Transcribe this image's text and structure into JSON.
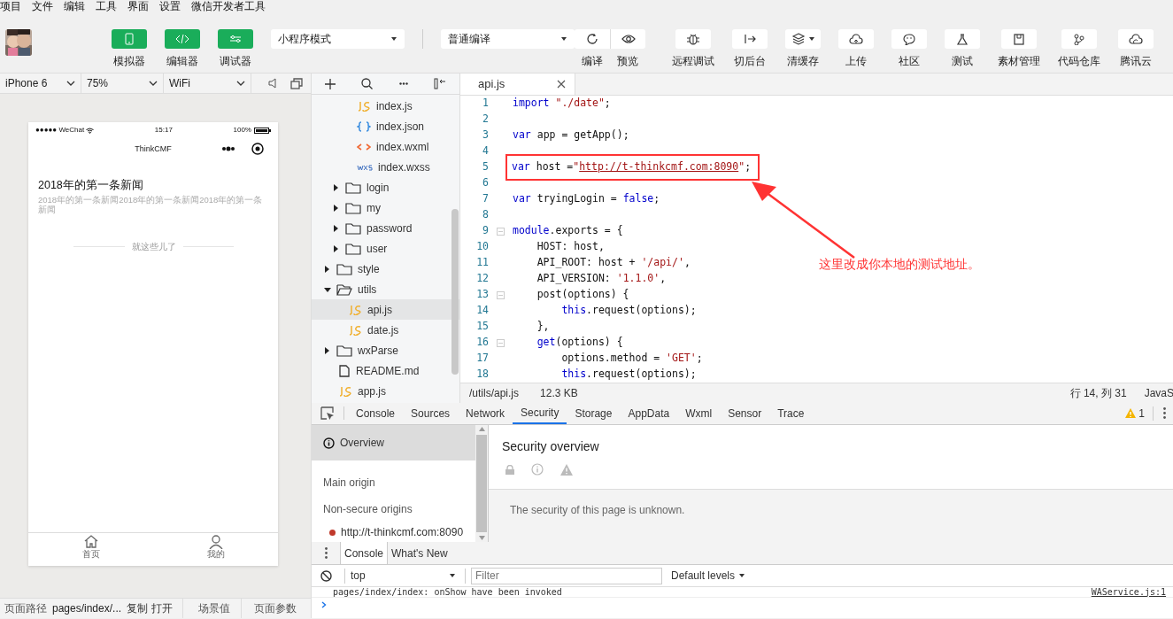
{
  "menu": [
    "项目",
    "文件",
    "编辑",
    "工具",
    "界面",
    "设置",
    "微信开发者工具"
  ],
  "toolbar": {
    "view_toggles": [
      {
        "label": "模拟器",
        "on": true
      },
      {
        "label": "编辑器",
        "on": true
      },
      {
        "label": "调试器",
        "on": true
      }
    ],
    "mode_select": {
      "value": "小程序模式"
    },
    "compile_select": {
      "value": "普通编译"
    },
    "compile_actions": [
      {
        "label": "编译"
      },
      {
        "label": "预览"
      }
    ],
    "actions": [
      {
        "label": "远程调试"
      },
      {
        "label": "切后台"
      },
      {
        "label": "清缓存",
        "has_menu": true
      },
      {
        "label": "上传"
      },
      {
        "label": "社区"
      },
      {
        "label": "测试"
      },
      {
        "label": "素材管理"
      },
      {
        "label": "代码仓库"
      },
      {
        "label": "腾讯云"
      }
    ]
  },
  "simulator": {
    "device": "iPhone 6",
    "zoom": "75%",
    "network": "WiFi",
    "phone": {
      "carrier": "●●●●● WeChat",
      "time": "15:17",
      "battery": "100%",
      "nav_title": "ThinkCMF",
      "news": [
        {
          "title": "2018年的第一条新闻",
          "summary": "2018年的第一条新闻2018年的第一条新闻2018年的第一条新闻"
        }
      ],
      "end_text": "就这些儿了",
      "tabs": [
        {
          "label": "首页"
        },
        {
          "label": "我的"
        }
      ]
    }
  },
  "page_status": {
    "path_label": "页面路径",
    "path": "pages/index/...",
    "copy": "复制",
    "open": "打开",
    "scene": "场景值",
    "params": "页面参数"
  },
  "file_tree": [
    {
      "children": [
        {
          "children": [
            {
              "name": "index.js",
              "kind": "js",
              "selected": false
            },
            {
              "name": "index.json",
              "kind": "json",
              "selected": false
            },
            {
              "name": "index.wxml",
              "kind": "wxml",
              "selected": false
            },
            {
              "name": "index.wxss",
              "kind": "wxss",
              "selected": false
            }
          ]
        },
        {
          "name": "login",
          "kind": "folder",
          "expanded": false,
          "selected": false
        },
        {
          "name": "my",
          "kind": "folder",
          "expanded": false,
          "selected": false
        },
        {
          "name": "password",
          "kind": "folder",
          "expanded": false,
          "selected": false
        },
        {
          "name": "user",
          "kind": "folder",
          "expanded": false,
          "selected": false
        }
      ]
    },
    {
      "name": "style",
      "kind": "folder",
      "expanded": false,
      "selected": false
    },
    {
      "name": "utils",
      "kind": "folder",
      "expanded": true,
      "selected": false,
      "children": [
        {
          "name": "api.js",
          "kind": "js",
          "selected": true
        },
        {
          "name": "date.js",
          "kind": "js",
          "selected": false
        }
      ]
    },
    {
      "name": "wxParse",
      "kind": "folder",
      "expanded": false,
      "selected": false
    },
    {
      "name": "README.md",
      "kind": "file",
      "selected": false
    },
    {
      "name": "app.js",
      "kind": "js",
      "selected": false
    }
  ],
  "editor": {
    "tabs": [
      {
        "label": "api.js",
        "selected": true
      }
    ],
    "lines": [
      {
        "number": "1",
        "tokens": [
          {
            "kind": "keyword",
            "text": "import"
          },
          {
            "kind": "string",
            "text": " \"./date\""
          },
          {
            "kind": "plain",
            "text": ";"
          }
        ]
      },
      {
        "number": "2"
      },
      {
        "number": "3",
        "tokens": [
          {
            "kind": "keyword",
            "text": "var"
          },
          {
            "kind": "plain",
            "text": " app = getApp();"
          }
        ]
      },
      {
        "number": "4"
      },
      {
        "number": "5",
        "highlighted": true,
        "tokens": [
          {
            "kind": "keyword",
            "text": "var"
          },
          {
            "kind": "plain",
            "text": " host ="
          },
          {
            "kind": "string",
            "text": "\""
          },
          {
            "kind": "url",
            "text": "http://t-thinkcmf.com:8090"
          },
          {
            "kind": "string",
            "text": "\""
          },
          {
            "kind": "plain",
            "text": ";"
          }
        ]
      },
      {
        "number": "6"
      },
      {
        "number": "7",
        "tokens": [
          {
            "kind": "keyword",
            "text": "var"
          },
          {
            "kind": "plain",
            "text": " tryingLogin = "
          },
          {
            "kind": "keyword",
            "text": "false"
          },
          {
            "kind": "plain",
            "text": ";"
          }
        ]
      },
      {
        "number": "8"
      },
      {
        "number": "9",
        "foldable": true,
        "tokens": [
          {
            "kind": "keyword",
            "text": "module"
          },
          {
            "kind": "plain",
            "text": ".exports = {"
          }
        ]
      },
      {
        "number": "10",
        "tokens": [
          {
            "kind": "plain",
            "text": "    HOST: host,"
          }
        ]
      },
      {
        "number": "11",
        "tokens": [
          {
            "kind": "plain",
            "text": "    API_ROOT: host + "
          },
          {
            "kind": "string",
            "text": "'/api/'"
          },
          {
            "kind": "plain",
            "text": ","
          }
        ]
      },
      {
        "number": "12",
        "tokens": [
          {
            "kind": "plain",
            "text": "    API_VERSION: "
          },
          {
            "kind": "string",
            "text": "'1.1.0'"
          },
          {
            "kind": "plain",
            "text": ","
          }
        ]
      },
      {
        "number": "13",
        "foldable": true,
        "tokens": [
          {
            "kind": "plain",
            "text": "    post(options) {"
          }
        ]
      },
      {
        "number": "14",
        "tokens": [
          {
            "kind": "keyword",
            "text": "        this"
          },
          {
            "kind": "plain",
            "text": ".request(options);"
          }
        ]
      },
      {
        "number": "15",
        "tokens": [
          {
            "kind": "plain",
            "text": "    },"
          }
        ]
      },
      {
        "number": "16",
        "foldable": true,
        "tokens": [
          {
            "kind": "keyword",
            "text": "    get"
          },
          {
            "kind": "plain",
            "text": "(options) {"
          }
        ]
      },
      {
        "number": "17",
        "tokens": [
          {
            "kind": "plain",
            "text": "        options.method = "
          },
          {
            "kind": "string",
            "text": "'GET'"
          },
          {
            "kind": "plain",
            "text": ";"
          }
        ]
      },
      {
        "number": "18",
        "tokens": [
          {
            "kind": "keyword",
            "text": "        this"
          },
          {
            "kind": "plain",
            "text": ".request(options);"
          }
        ]
      }
    ],
    "annotation": {
      "text": "这里改成你本地的测试地址。"
    },
    "status": {
      "path": "/utils/api.js",
      "size": "12.3 KB",
      "position": "行 14, 列 31",
      "language": "JavaS"
    }
  },
  "devtools": {
    "tabs": [
      {
        "label": "Console",
        "selected": false
      },
      {
        "label": "Sources",
        "selected": false
      },
      {
        "label": "Network",
        "selected": false
      },
      {
        "label": "Security",
        "selected": true
      },
      {
        "label": "Storage",
        "selected": false
      },
      {
        "label": "AppData",
        "selected": false
      },
      {
        "label": "Wxml",
        "selected": false
      },
      {
        "label": "Sensor",
        "selected": false
      },
      {
        "label": "Trace",
        "selected": false
      }
    ],
    "warnings": "1",
    "security": {
      "sidebar": [
        {
          "label": "Overview",
          "kind": "overview",
          "selected": true
        },
        {
          "label": "Main origin",
          "kind": "heading",
          "selected": false
        },
        {
          "label": "Non-secure origins",
          "kind": "heading",
          "selected": false
        },
        {
          "label": "http://t-thinkcmf.com:8090",
          "kind": "origin",
          "color": "#c0392b",
          "selected": false
        }
      ],
      "title": "Security overview",
      "message": "The security of this page is unknown."
    },
    "drawer": {
      "tabs": [
        {
          "label": "Console",
          "selected": true
        },
        {
          "label": "What's New",
          "selected": false
        }
      ],
      "context": "top",
      "filter_placeholder": "Filter",
      "levels": "Default levels",
      "log": [
        {
          "text": "pages/index/index: onShow have been invoked",
          "source": "WAService.js:1"
        }
      ]
    }
  }
}
